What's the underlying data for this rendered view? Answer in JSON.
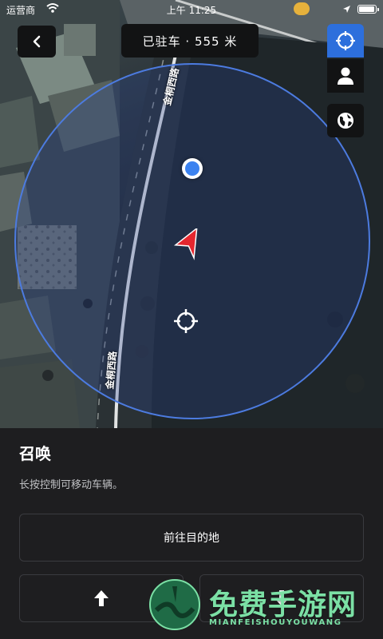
{
  "status_bar": {
    "carrier": "运营商",
    "time": "上午 11:25"
  },
  "map": {
    "street_name_top": "金桐西路",
    "street_name_bottom": "金桐西路",
    "icons": {
      "current_location": "blue-dot-icon",
      "car": "red-arrow-icon",
      "target": "crosshair-icon"
    }
  },
  "header": {
    "back_icon": "chevron-left-icon",
    "parked_status": "已驻车 · 555 米"
  },
  "side_controls": {
    "locate_icon": "locate-icon",
    "person_icon": "person-icon",
    "globe_icon": "globe-icon"
  },
  "sheet": {
    "title": "召唤",
    "subtitle": "长按控制可移动车辆。",
    "destination_label": "前往目的地",
    "forward_icon": "arrow-up-icon",
    "reverse_icon": "arrow-down-icon"
  },
  "watermark": {
    "text": "免费手游网",
    "sub": "MIANFEISHOUYOUWANG"
  },
  "colors": {
    "accent_blue": "#2d6fdc",
    "car_red": "#e5262e",
    "background": "#1e1e20",
    "watermark_green": "#7be0a5"
  }
}
